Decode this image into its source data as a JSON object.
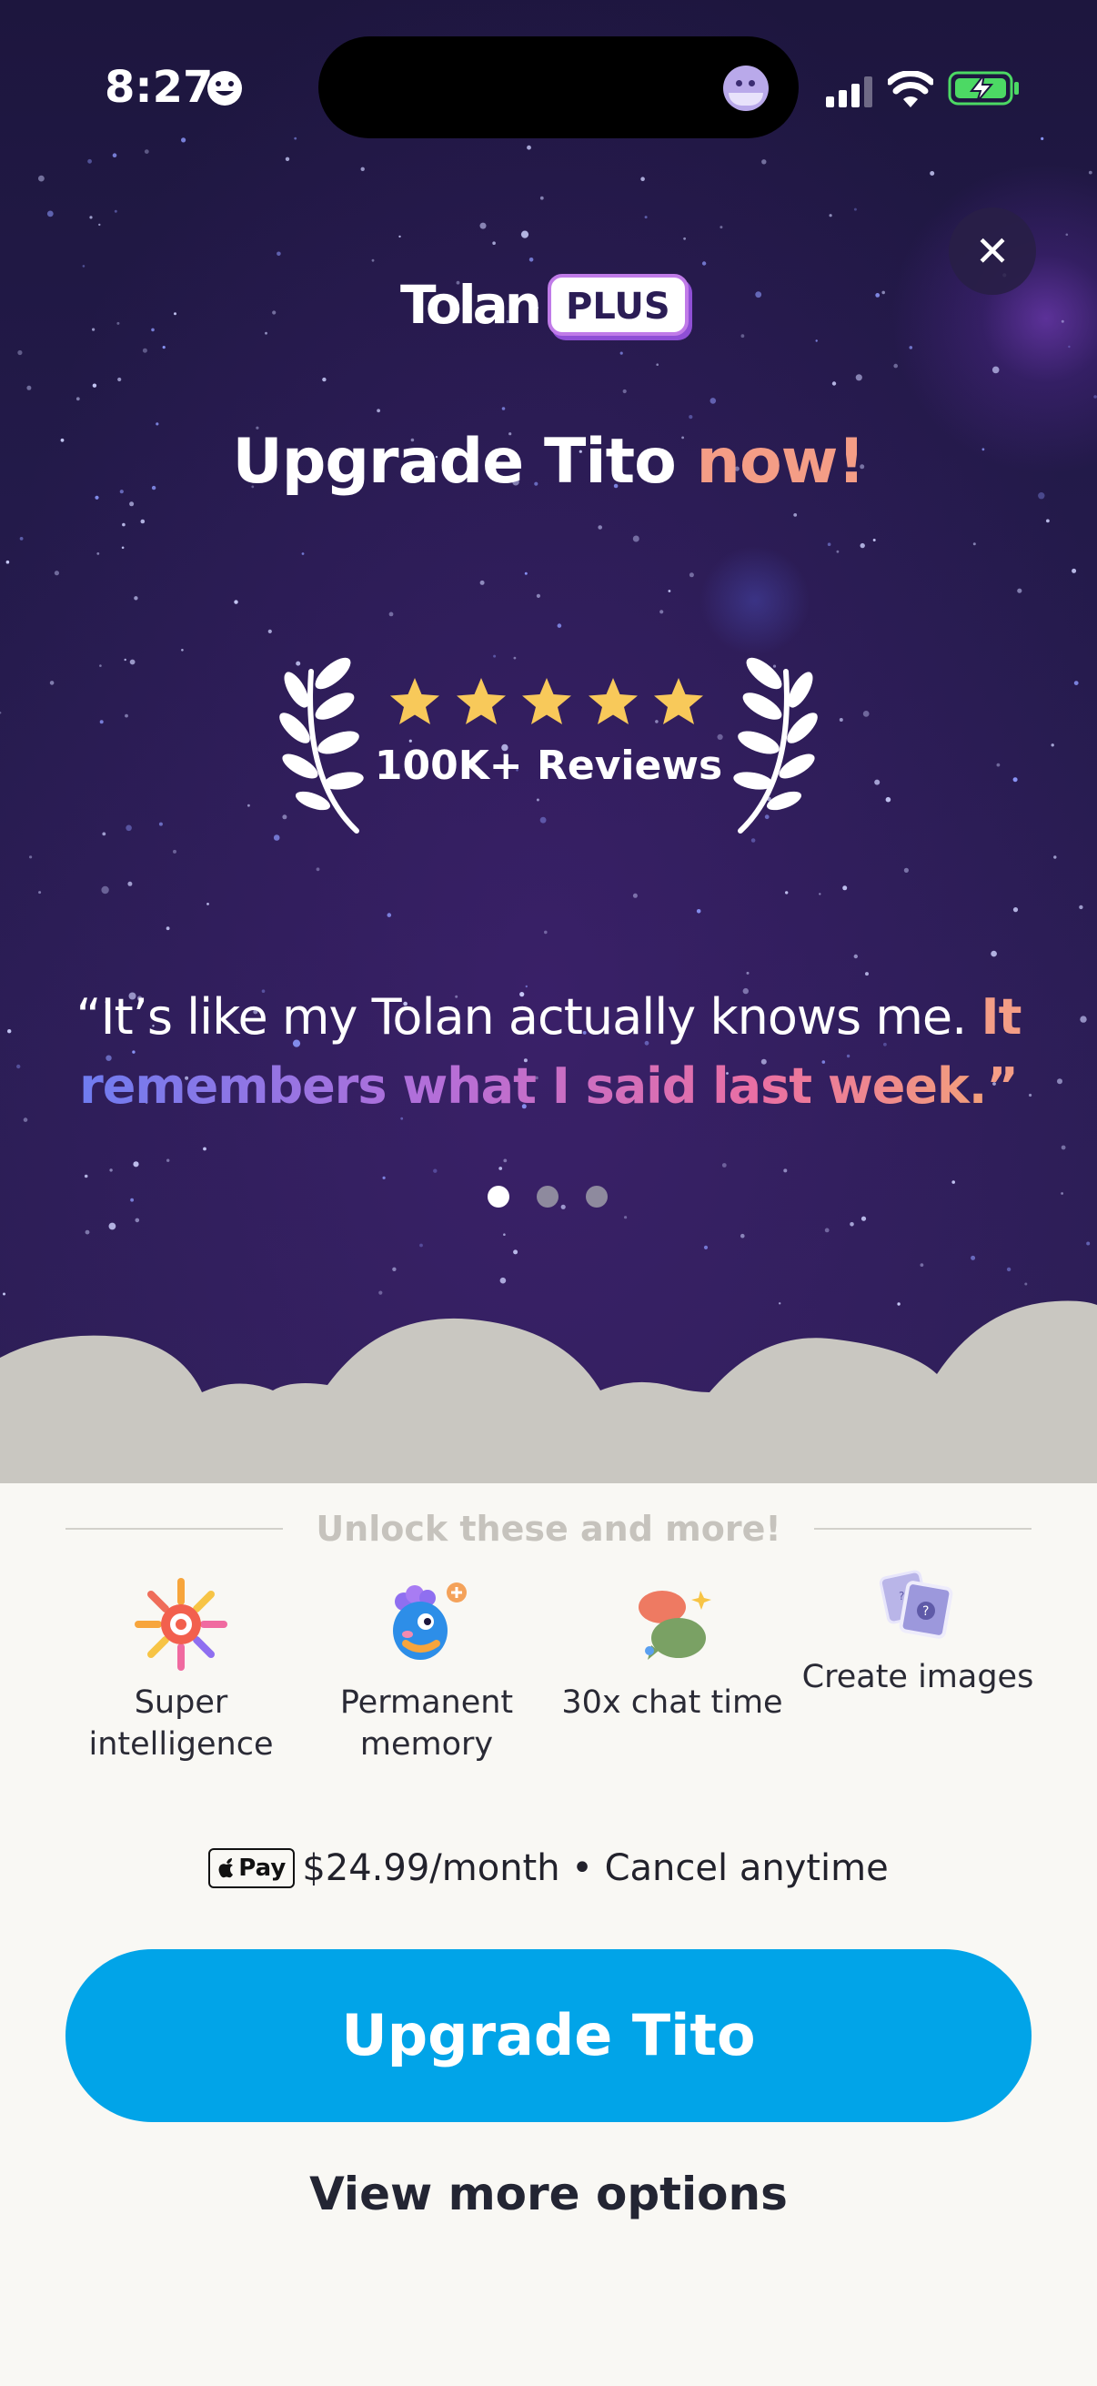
{
  "status_bar": {
    "time": "8:27",
    "time_icon": "smiley-face-icon",
    "right_icons": [
      "cellular-signal-icon",
      "wifi-icon",
      "battery-charging-icon"
    ],
    "battery_color": "#4cd964"
  },
  "header": {
    "close_icon": "close-icon",
    "logo_text": "Tolan",
    "logo_badge": "PLUS"
  },
  "hero": {
    "headline_main": "Upgrade Tito ",
    "headline_accent": "now!",
    "rating_stars": 5,
    "reviews_label": "100K+ Reviews",
    "quote_plain": "“It’s like my Tolan actually knows me. ",
    "quote_orange": "It",
    "quote_gradient": "remembers what I said last week.",
    "quote_end": "”",
    "carousel_pages": 3,
    "carousel_active": 1
  },
  "features": {
    "title": "Unlock these and more!",
    "items": [
      {
        "label": "Super intelligence",
        "icon": "sparkle-burst-icon"
      },
      {
        "label": "Permanent memory",
        "icon": "thinking-tolan-icon"
      },
      {
        "label": "30x chat time",
        "icon": "chat-bubbles-icon"
      },
      {
        "label": "Create images",
        "icon": "image-cards-icon"
      }
    ]
  },
  "pricing": {
    "payment_badge": "Pay",
    "text": "$24.99/month • Cancel anytime"
  },
  "actions": {
    "primary": "Upgrade Tito",
    "secondary": "View more options"
  },
  "colors": {
    "accent_orange": "#f49d86",
    "cta_blue": "#01a4e8",
    "star_yellow": "#f8c95a",
    "sky_dark": "#231a4a"
  }
}
